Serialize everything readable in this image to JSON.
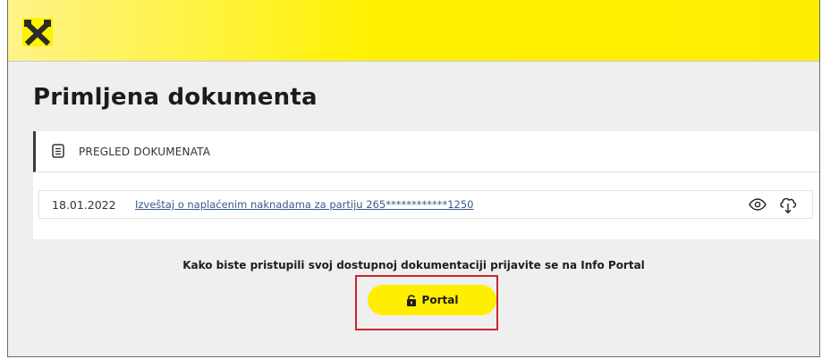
{
  "header": {
    "logo_icon": "raiffeisen-cross-icon",
    "accent_color": "#fff200"
  },
  "page": {
    "title": "Primljena dokumenta"
  },
  "card": {
    "header_icon": "document-icon",
    "header_label": "PREGLED DOKUMENATA",
    "documents": [
      {
        "date": "18.01.2022",
        "title": "Izveštaj o naplaćenim naknadama za partiju 265************1250",
        "actions": [
          "eye-icon",
          "cloud-download-icon"
        ]
      }
    ]
  },
  "info": {
    "text": "Kako biste pristupili svoj dostupnoj dokumentaciji prijavite se na Info Portal"
  },
  "portal_button": {
    "label": "Portal",
    "icon": "unlock-icon",
    "color": "#ffee00",
    "highlight_color": "#c8262e"
  }
}
